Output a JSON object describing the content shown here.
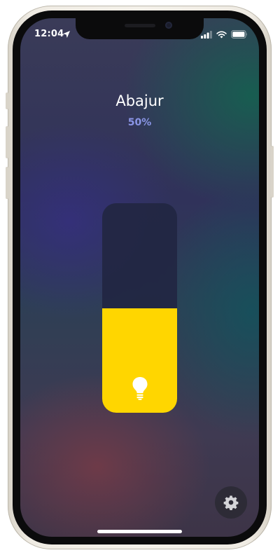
{
  "status_bar": {
    "time": "12:04",
    "location_icon": "location-arrow-icon",
    "signal_icon": "cellular-signal-icon",
    "wifi_icon": "wifi-icon",
    "battery_icon": "battery-icon"
  },
  "accessory": {
    "name": "Abajur",
    "brightness_label": "50%",
    "brightness_fraction": 0.5,
    "fill_color": "#ffd600",
    "icon": "lightbulb-icon"
  },
  "settings_button": {
    "icon": "gear-icon"
  }
}
